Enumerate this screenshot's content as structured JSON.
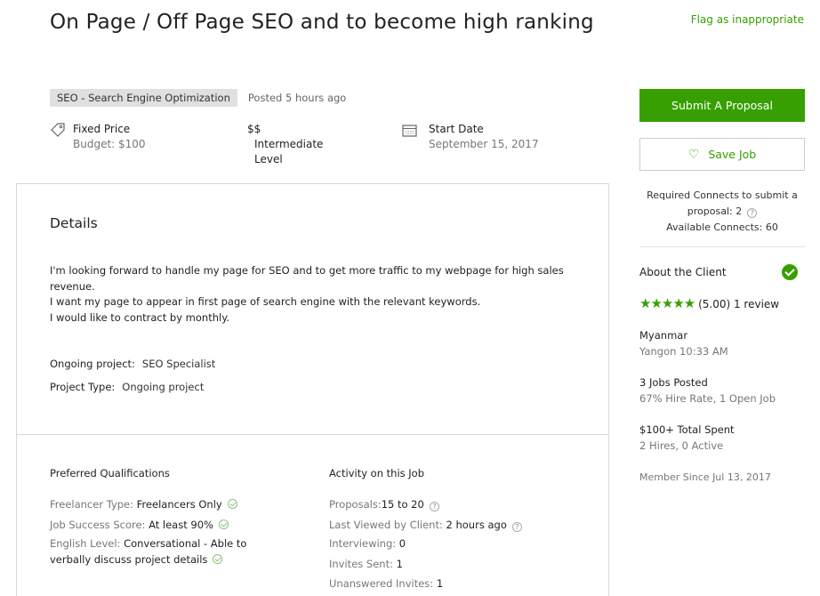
{
  "header": {
    "title": "On Page / Off Page SEO and to become high ranking",
    "flag_label": "Flag as inappropriate",
    "category": "SEO - Search Engine Optimization",
    "posted": "Posted 5 hours ago"
  },
  "meta": {
    "price_label": "Fixed Price",
    "budget": "Budget: $100",
    "level_symbol": "$$",
    "level_label": "Intermediate",
    "level_label2": "Level",
    "start_label": "Start Date",
    "start_date": "September 15, 2017"
  },
  "details": {
    "heading": "Details",
    "line1": "I'm looking forward to handle my page for SEO and to get more traffic to my webpage for high sales revenue.",
    "line2": "I want my page to appear in first page of search engine with the relevant keywords.",
    "line3": "I would like to contract by monthly.",
    "ongoing_key": "Ongoing project:",
    "ongoing_value": "SEO Specialist",
    "type_key": "Project Type:",
    "type_value": "Ongoing project"
  },
  "qualifications": {
    "heading": "Preferred Qualifications",
    "freelancer_key": "Freelancer Type:",
    "freelancer_value": "Freelancers Only",
    "jss_key": "Job Success Score:",
    "jss_value": "At least 90%",
    "english_key": "English Level:",
    "english_value": "Conversational - Able to",
    "english_value2": "verbally discuss project details"
  },
  "activity": {
    "heading": "Activity on this Job",
    "proposals_key": "Proposals:",
    "proposals_value": "15 to 20",
    "viewed_key": "Last Viewed by Client:",
    "viewed_value": "2 hours ago",
    "interviewing_key": "Interviewing:",
    "interviewing_value": "0",
    "invites_key": "Invites Sent:",
    "invites_value": "1",
    "unanswered_key": "Unanswered Invites:",
    "unanswered_value": "1"
  },
  "sidebar": {
    "submit_label": "Submit A Proposal",
    "save_label": "Save Job",
    "connects_line1": "Required Connects to submit a",
    "connects_line2": "proposal: 2",
    "connects_line3": "Available Connects: 60",
    "about_label": "About the Client",
    "stars": "★★★★★",
    "rating": "(5.00) 1 review",
    "country": "Myanmar",
    "city_time": "Yangon 10:33 AM",
    "jobs_posted": "3 Jobs Posted",
    "hire_rate": "67% Hire Rate, 1 Open Job",
    "total_spent": "$100+ Total Spent",
    "hires": "2 Hires, 0 Active",
    "member_since": "Member Since Jul 13, 2017"
  },
  "colors": {
    "accent": "#37a000",
    "tag_bg": "#e0e0e0",
    "border": "#d9d9d9"
  },
  "icons": {
    "price": "price-tag-icon",
    "calendar": "calendar-icon",
    "heart": "heart-icon",
    "verified": "verified-check-icon",
    "check": "check-circle-icon",
    "help": "question-circle-icon"
  }
}
